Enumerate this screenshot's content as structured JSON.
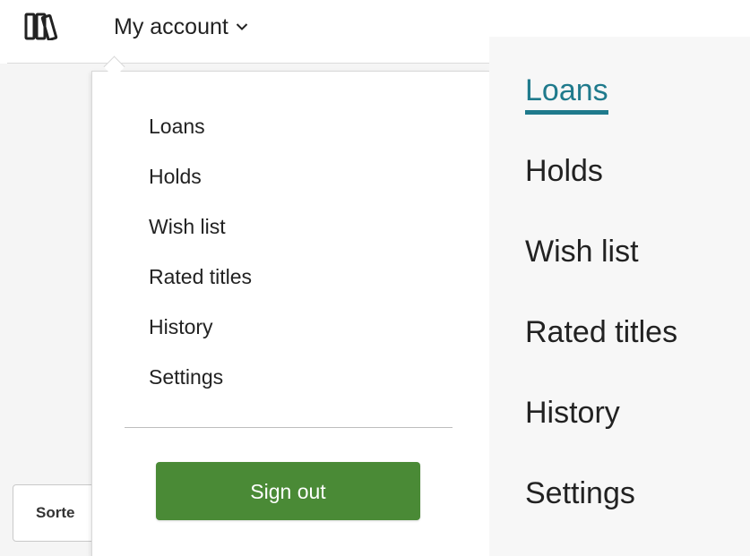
{
  "header": {
    "account_label": "My account"
  },
  "dropdown": {
    "items": [
      {
        "label": "Loans"
      },
      {
        "label": "Holds"
      },
      {
        "label": "Wish list"
      },
      {
        "label": "Rated titles"
      },
      {
        "label": "History"
      },
      {
        "label": "Settings"
      }
    ],
    "sign_out_label": "Sign out"
  },
  "background": {
    "sorted_chip_label": "Sorte"
  },
  "side_nav": {
    "active_item": "Loans",
    "items": [
      {
        "label": "Loans"
      },
      {
        "label": "Holds"
      },
      {
        "label": "Wish list"
      },
      {
        "label": "Rated titles"
      },
      {
        "label": "History"
      },
      {
        "label": "Settings"
      }
    ]
  },
  "colors": {
    "accent": "#1f7a8c",
    "sign_out_green": "#4a8a36"
  },
  "icons": {
    "logo": "books-library-icon",
    "account_toggle": "chevron-down-icon"
  }
}
